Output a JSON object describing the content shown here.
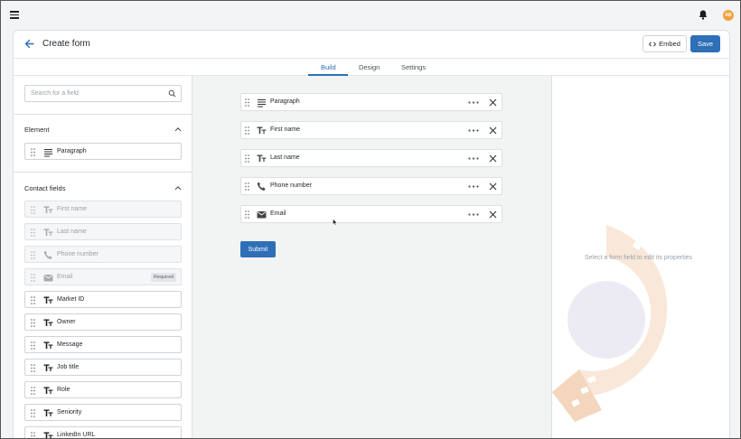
{
  "topbar": {
    "menu_icon": "hamburger-icon",
    "notifications_icon": "bell-icon",
    "avatar_initials": "AB",
    "avatar_color": "#f3a13c"
  },
  "header": {
    "title": "Create form",
    "embed_label": "Embed",
    "save_label": "Save"
  },
  "tabs": [
    {
      "label": "Build",
      "active": true
    },
    {
      "label": "Design",
      "active": false
    },
    {
      "label": "Settings",
      "active": false
    }
  ],
  "sidebar": {
    "search_placeholder": "Search for a field",
    "element_section": {
      "title": "Element",
      "items": [
        {
          "label": "Paragraph",
          "icon": "paragraph-icon"
        }
      ]
    },
    "contact_section": {
      "title": "Contact fields",
      "items": [
        {
          "label": "First name",
          "icon": "text-icon",
          "disabled": true
        },
        {
          "label": "Last name",
          "icon": "text-icon",
          "disabled": true
        },
        {
          "label": "Phone number",
          "icon": "phone-icon",
          "disabled": true
        },
        {
          "label": "Email",
          "icon": "email-icon",
          "disabled": true,
          "badge": "Required"
        },
        {
          "label": "Market ID",
          "icon": "text-icon",
          "disabled": false
        },
        {
          "label": "Owner",
          "icon": "text-icon",
          "disabled": false
        },
        {
          "label": "Message",
          "icon": "text-icon",
          "disabled": false
        },
        {
          "label": "Job title",
          "icon": "text-icon",
          "disabled": false
        },
        {
          "label": "Role",
          "icon": "text-icon",
          "disabled": false
        },
        {
          "label": "Seniority",
          "icon": "text-icon",
          "disabled": false
        },
        {
          "label": "LinkedIn URL",
          "icon": "text-icon",
          "disabled": false
        }
      ]
    }
  },
  "canvas": {
    "fields": [
      {
        "label": "Paragraph",
        "icon": "paragraph-icon"
      },
      {
        "label": "First name",
        "icon": "text-icon"
      },
      {
        "label": "Last name",
        "icon": "text-icon"
      },
      {
        "label": "Phone number",
        "icon": "phone-icon"
      },
      {
        "label": "Email",
        "icon": "email-icon"
      }
    ],
    "submit_label": "Submit"
  },
  "properties": {
    "hint": "Select a form field to edit its properties"
  },
  "colors": {
    "accent": "#2f6fb7",
    "watermark_orange": "#f7e2cf",
    "watermark_lavender": "#ecebf3"
  }
}
